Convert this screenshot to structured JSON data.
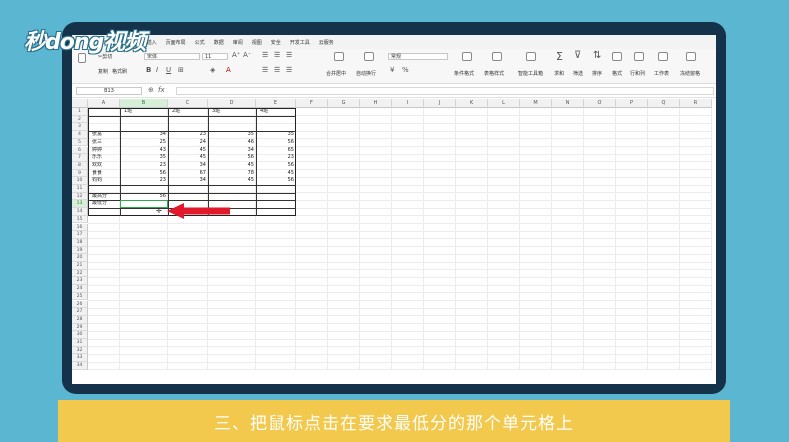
{
  "logo": "秒dong视频",
  "caption": "三、把鼠标点击在要求最低分的那个单元格上",
  "menu": [
    "开始",
    "插入",
    "页面布局",
    "公式",
    "数据",
    "审阅",
    "视图",
    "安全",
    "开发工具",
    "云服务"
  ],
  "menu_active_index": 0,
  "ribbon": {
    "cut": "剪切",
    "copy": "复制",
    "format_painter": "格式刷",
    "font_name": "宋体",
    "font_size": "11",
    "merge_center": "合并居中",
    "wrap": "自动换行",
    "number_format": "常规",
    "cond_format": "条件格式",
    "table_style": "表格样式",
    "smart_tools": "智能工具箱",
    "sum": "求和",
    "filter": "筛选",
    "sort": "排序",
    "format": "格式",
    "rowcol": "行和列",
    "worksheet": "工作表",
    "freeze": "冻结窗格"
  },
  "formula_bar": {
    "name_box": "B13",
    "fx": "fx",
    "value": ""
  },
  "columns": [
    "A",
    "B",
    "C",
    "D",
    "E",
    "F",
    "G",
    "H",
    "I",
    "J",
    "K",
    "L",
    "M",
    "N",
    "O",
    "P",
    "Q",
    "R"
  ],
  "rows": [
    "1",
    "2",
    "3",
    "4",
    "5",
    "6",
    "7",
    "8",
    "9",
    "10",
    "11",
    "12",
    "13",
    "14",
    "15",
    "16",
    "17",
    "18",
    "19",
    "20",
    "21",
    "22",
    "23",
    "24",
    "25",
    "26",
    "27",
    "28",
    "29",
    "30",
    "31",
    "32",
    "33",
    "34"
  ],
  "sheet": {
    "headers": [
      "1班",
      "2班",
      "3班",
      "4班"
    ],
    "students": [
      {
        "name": "张富",
        "scores": [
          "34",
          "23",
          "35",
          "35"
        ]
      },
      {
        "name": "张三",
        "scores": [
          "25",
          "24",
          "46",
          "56"
        ]
      },
      {
        "name": "婷婷",
        "scores": [
          "43",
          "45",
          "34",
          "65"
        ]
      },
      {
        "name": "乐乐",
        "scores": [
          "35",
          "45",
          "56",
          "23"
        ]
      },
      {
        "name": "欢欢",
        "scores": [
          "23",
          "34",
          "45",
          "56"
        ]
      },
      {
        "name": "食食",
        "scores": [
          "56",
          "67",
          "78",
          "45"
        ]
      },
      {
        "name": "钧钧",
        "scores": [
          "23",
          "34",
          "45",
          "56"
        ]
      }
    ],
    "max_label": "最高分",
    "max_value": "56",
    "min_label": "最低分"
  },
  "colors": {
    "accent": "#2fa84f",
    "arrow": "#e0192d",
    "frame": "#15324b",
    "caption_bg": "#f2c94c",
    "bg": "#5bb6d2"
  },
  "icons": [
    "cursor-plus-icon",
    "arrow-left-icon"
  ]
}
